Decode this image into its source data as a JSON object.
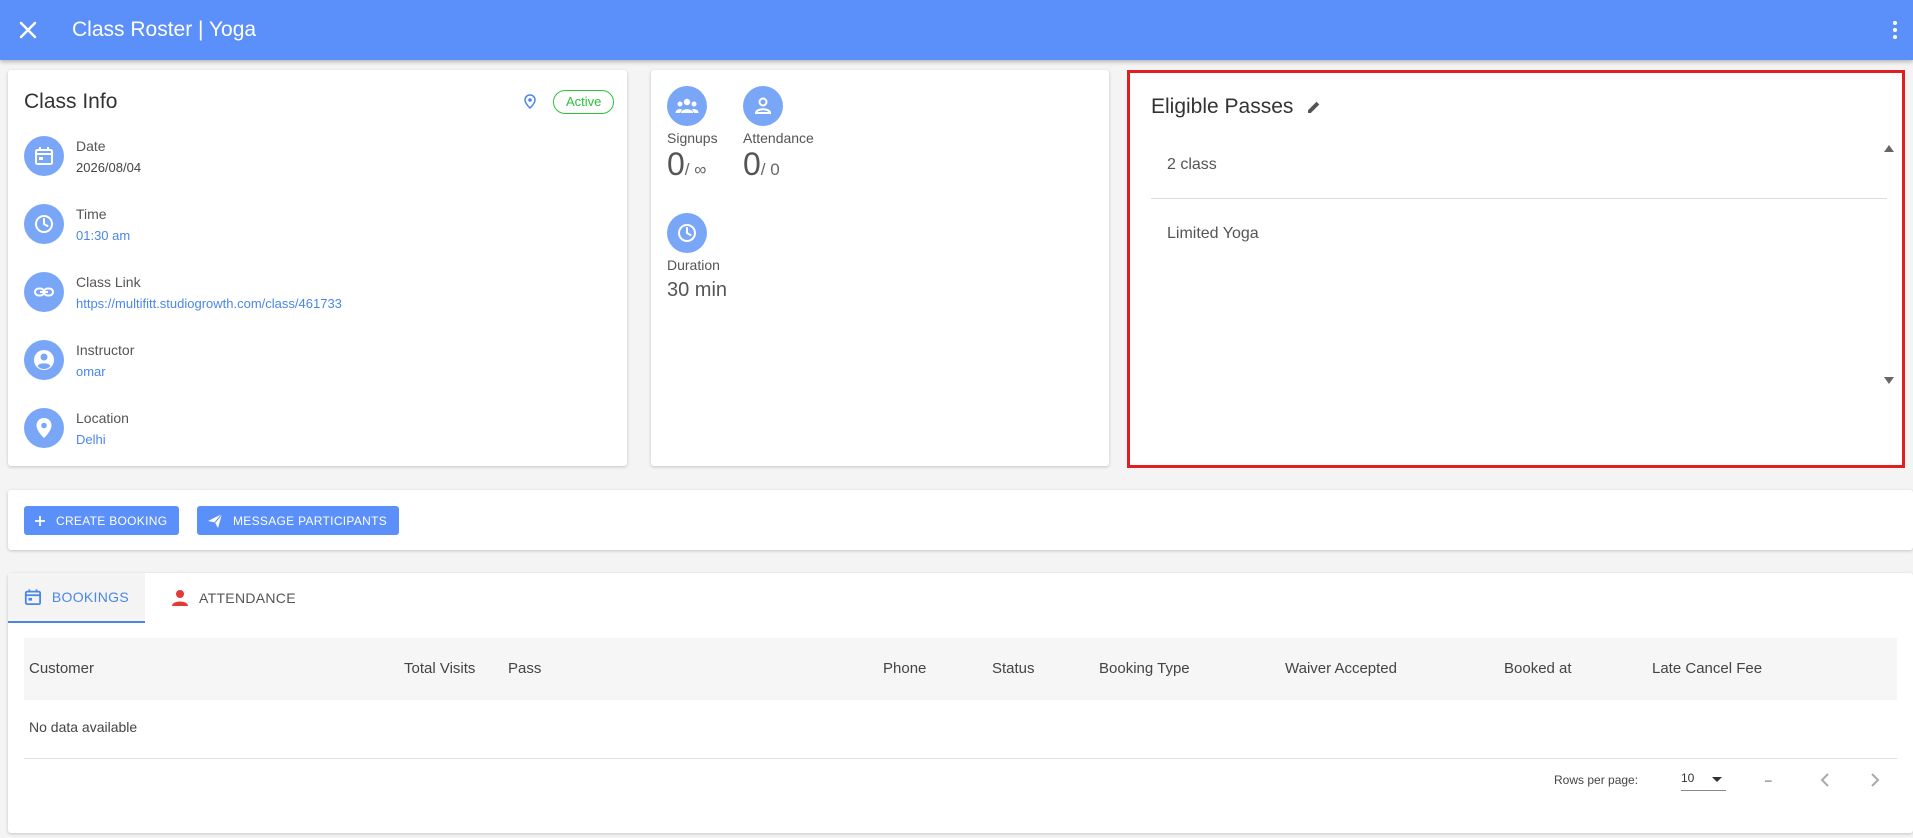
{
  "header": {
    "title": "Class Roster | Yoga"
  },
  "class_info": {
    "title": "Class Info",
    "status": "Active",
    "date": {
      "label": "Date",
      "value": "2026/08/04"
    },
    "time": {
      "label": "Time",
      "value": "01:30 am"
    },
    "link": {
      "label": "Class Link",
      "value": "https://multifitt.studiogrowth.com/class/461733"
    },
    "instructor": {
      "label": "Instructor",
      "value": "omar"
    },
    "location": {
      "label": "Location",
      "value": "Delhi"
    }
  },
  "stats": {
    "signups": {
      "label": "Signups",
      "count": "0",
      "limit": "/ ∞"
    },
    "attendance": {
      "label": "Attendance",
      "count": "0",
      "limit": "/ 0"
    },
    "duration": {
      "label": "Duration",
      "value": "30 min"
    }
  },
  "passes": {
    "title": "Eligible Passes",
    "items": [
      "2 class",
      "Limited Yoga"
    ]
  },
  "actions": {
    "create_booking": "CREATE BOOKING",
    "message_participants": "MESSAGE PARTICIPANTS"
  },
  "tabs": [
    "BOOKINGS",
    "ATTENDANCE"
  ],
  "table": {
    "columns": [
      "Customer",
      "Total Visits",
      "Pass",
      "Phone",
      "Status",
      "Booking Type",
      "Waiver Accepted",
      "Booked at",
      "Late Cancel Fee"
    ],
    "empty_text": "No data available",
    "rows_per_page_label": "Rows per page:",
    "rows_per_page": "10",
    "range": "–"
  },
  "colors": {
    "primary": "#5b8ff9",
    "active": "#2bc23d",
    "highlight": "#e02020"
  }
}
